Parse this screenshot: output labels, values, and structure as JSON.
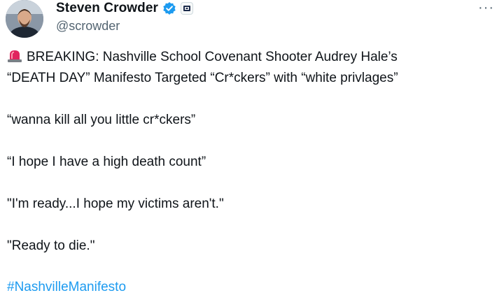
{
  "author": {
    "display_name": "Steven Crowder",
    "handle": "@scrowder",
    "avatar_icon": "profile-photo",
    "verified_icon": "verified-badge-icon",
    "affiliate_icon": "affiliate-badge-icon"
  },
  "menu": {
    "more_label": "···"
  },
  "tweet": {
    "line1": "BREAKING: Nashville School Covenant Shooter Audrey Hale’s",
    "line2": "“DEATH DAY” Manifesto Targeted “Cr*ckers” with “white privlages”",
    "quote1": "“wanna kill all you little cr*ckers”",
    "quote2": "“I hope I have a high death count”",
    "quote3": "\"I'm ready...I hope my victims aren't.\"",
    "quote4": "\"Ready to die.\"",
    "hashtag": "#NashvilleManifesto"
  },
  "colors": {
    "hashtag": "#1d9bf0",
    "verified": "#1d9bf0",
    "siren": "#e0245e"
  }
}
